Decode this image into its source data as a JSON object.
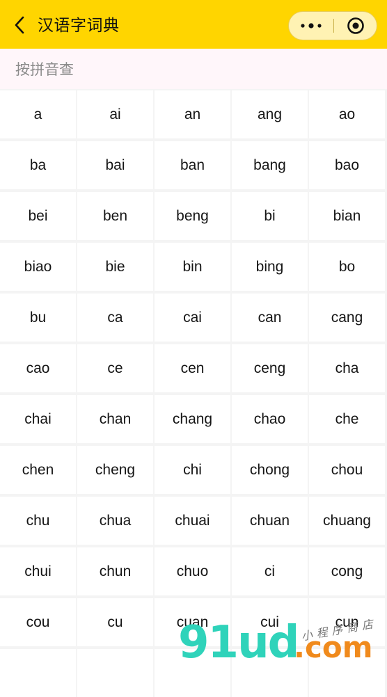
{
  "header": {
    "title": "汉语字词典",
    "back_icon": "chevron-left-icon",
    "more_icon": "more-dots-icon",
    "close_icon": "target-close-icon",
    "background": "#ffd500"
  },
  "search": {
    "placeholder": "按拼音查"
  },
  "pinyin": [
    "a",
    "ai",
    "an",
    "ang",
    "ao",
    "ba",
    "bai",
    "ban",
    "bang",
    "bao",
    "bei",
    "ben",
    "beng",
    "bi",
    "bian",
    "biao",
    "bie",
    "bin",
    "bing",
    "bo",
    "bu",
    "ca",
    "cai",
    "can",
    "cang",
    "cao",
    "ce",
    "cen",
    "ceng",
    "cha",
    "chai",
    "chan",
    "chang",
    "chao",
    "che",
    "chen",
    "cheng",
    "chi",
    "chong",
    "chou",
    "chu",
    "chua",
    "chuai",
    "chuan",
    "chuang",
    "chui",
    "chun",
    "chuo",
    "ci",
    "cong",
    "cou",
    "cu",
    "cuan",
    "cui",
    "cun",
    "",
    "",
    "",
    "",
    ""
  ],
  "watermark": {
    "main": "91ud",
    "suffix": ".com",
    "small": "小程序商店"
  }
}
